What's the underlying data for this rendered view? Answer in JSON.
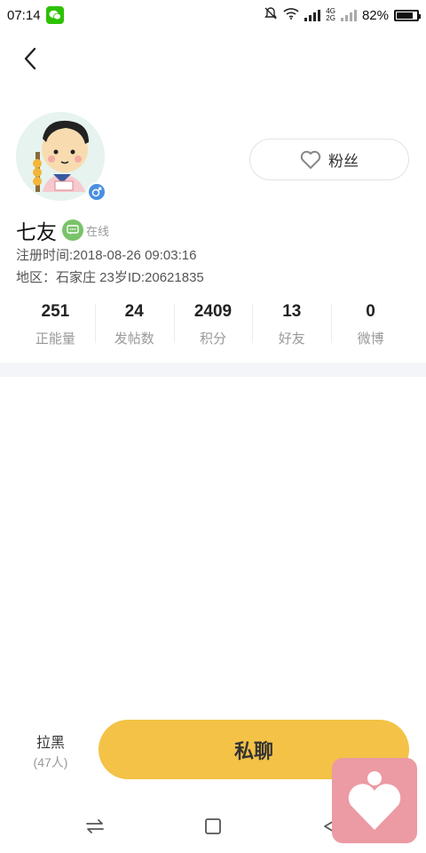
{
  "status": {
    "time": "07:14",
    "network_labels": [
      "4G",
      "2G"
    ],
    "battery_text": "82%",
    "battery_level": 0.82,
    "icons": [
      "wechat-icon",
      "mute-bell-icon",
      "wifi-icon",
      "signal-icon",
      "battery-icon"
    ]
  },
  "profile": {
    "name": "七友",
    "online_text": "在线",
    "registration": "注册时间:2018-08-26 09:03:16",
    "region": "地区：石家庄   23岁ID:20621835"
  },
  "fans_button": {
    "label": "粉丝",
    "icon": "heart-outline-icon"
  },
  "stats": [
    {
      "value": "251",
      "label": "正能量"
    },
    {
      "value": "24",
      "label": "发帖数"
    },
    {
      "value": "2409",
      "label": "积分"
    },
    {
      "value": "13",
      "label": "好友"
    },
    {
      "value": "0",
      "label": "微博"
    }
  ],
  "actions": {
    "block_label": "拉黑",
    "block_count": "(47人)",
    "chat_label": "私聊"
  },
  "colors": {
    "accent_yellow": "#f3c246",
    "online_green": "#79c36a",
    "gender_blue": "#4a8fe0",
    "float_pink": "#ec9aa3"
  }
}
